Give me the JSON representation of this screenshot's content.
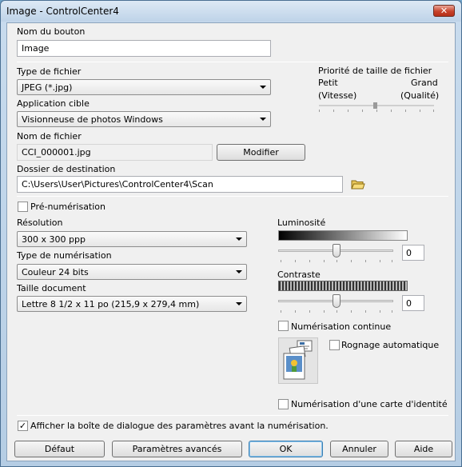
{
  "window": {
    "title": "Image - ControlCenter4",
    "close_glyph": "✕"
  },
  "button_name": {
    "label": "Nom du bouton",
    "value": "Image"
  },
  "file_type": {
    "label": "Type de fichier",
    "selected": "JPEG (*.jpg)"
  },
  "target_app": {
    "label": "Application cible",
    "selected": "Visionneuse de photos Windows"
  },
  "file_size_priority": {
    "label": "Priorité de taille de fichier",
    "left_label": "Petit",
    "right_label": "Grand",
    "left_sub": "(Vitesse)",
    "right_sub": "(Qualité)",
    "level_fraction": 0.5
  },
  "file_name": {
    "label": "Nom de fichier",
    "value": "CCI_000001.jpg",
    "modify_button": "Modifier"
  },
  "destination": {
    "label": "Dossier de destination",
    "value": "C:\\Users\\User\\Pictures\\ControlCenter4\\Scan",
    "folder_icon": "folder-icon"
  },
  "prescan": {
    "label": "Pré-numérisation",
    "checked": false
  },
  "resolution": {
    "label": "Résolution",
    "selected": "300 x 300 ppp"
  },
  "scan_type": {
    "label": "Type de numérisation",
    "selected": "Couleur 24 bits"
  },
  "doc_size": {
    "label": "Taille document",
    "selected": "Lettre 8 1/2 x 11 po (215,9 x 279,4 mm)"
  },
  "brightness": {
    "label": "Luminosité",
    "value": "0",
    "level_fraction": 0.5
  },
  "contrast": {
    "label": "Contraste",
    "value": "0",
    "level_fraction": 0.5
  },
  "continuous_scan": {
    "label": "Numérisation continue",
    "checked": false
  },
  "auto_crop": {
    "label": "Rognage automatique",
    "checked": false
  },
  "id_card_scan": {
    "label": "Numérisation d'une carte d'identité",
    "checked": false
  },
  "show_dialog": {
    "label": "Afficher la boîte de dialogue des paramètres avant la numérisation.",
    "checked": true,
    "check_glyph": "✓"
  },
  "buttons": {
    "default": "Défaut",
    "advanced": "Paramètres avancés",
    "ok": "OK",
    "cancel": "Annuler",
    "help": "Aide"
  }
}
